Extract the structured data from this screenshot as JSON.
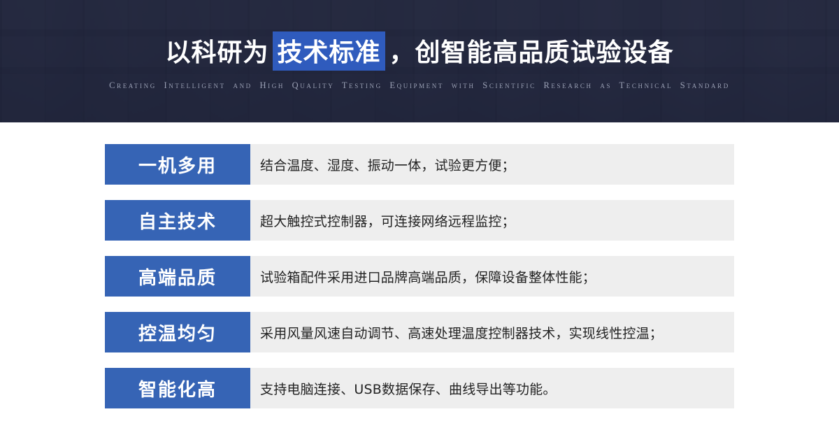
{
  "hero": {
    "title_part1": "以科研为",
    "title_highlight": "技术标准",
    "title_part2": "，创智能高品质试验设备",
    "subtitle": "Creating Intelligent and High Quality Testing Equipment with Scientific Research as Technical Standard",
    "highlight_color": "#2f5bbd",
    "overlay_color": "#20253e"
  },
  "features": {
    "tag_color": "#3664b5",
    "panel_color": "#eeeeee",
    "items": [
      {
        "tag": "一机多用",
        "desc": "结合温度、湿度、振动一体，试验更方便；"
      },
      {
        "tag": "自主技术",
        "desc": "超大触控式控制器，可连接网络远程监控；"
      },
      {
        "tag": "高端品质",
        "desc": "试验箱配件采用进口品牌高端品质，保障设备整体性能；"
      },
      {
        "tag": "控温均匀",
        "desc": "采用风量风速自动调节、高速处理温度控制器技术，实现线性控温；"
      },
      {
        "tag": "智能化高",
        "desc": "支持电脑连接、USB数据保存、曲线导出等功能。"
      }
    ]
  }
}
